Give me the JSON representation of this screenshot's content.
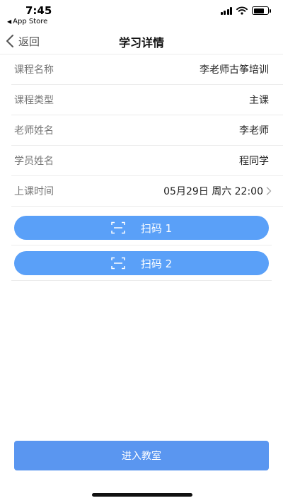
{
  "status_bar": {
    "time": "7:45",
    "back_app": "App Store"
  },
  "nav": {
    "back_label": "返回",
    "title": "学习详情"
  },
  "details": [
    {
      "key": "课程名称",
      "value": "李老师古筝培训"
    },
    {
      "key": "课程类型",
      "value": "主课"
    },
    {
      "key": "老师姓名",
      "value": "李老师"
    },
    {
      "key": "学员姓名",
      "value": "程同学"
    },
    {
      "key": "上课时间",
      "value": "05月29日 周六 22:00"
    }
  ],
  "scan_buttons": [
    {
      "label": "扫码 1",
      "icon": "scan-icon"
    },
    {
      "label": "扫码 2",
      "icon": "scan-icon"
    }
  ],
  "enter_button": {
    "label": "进入教室"
  },
  "colors": {
    "button_blue": "#5aa0f8",
    "enter_blue": "#5a96f0",
    "divider": "#ececec"
  }
}
